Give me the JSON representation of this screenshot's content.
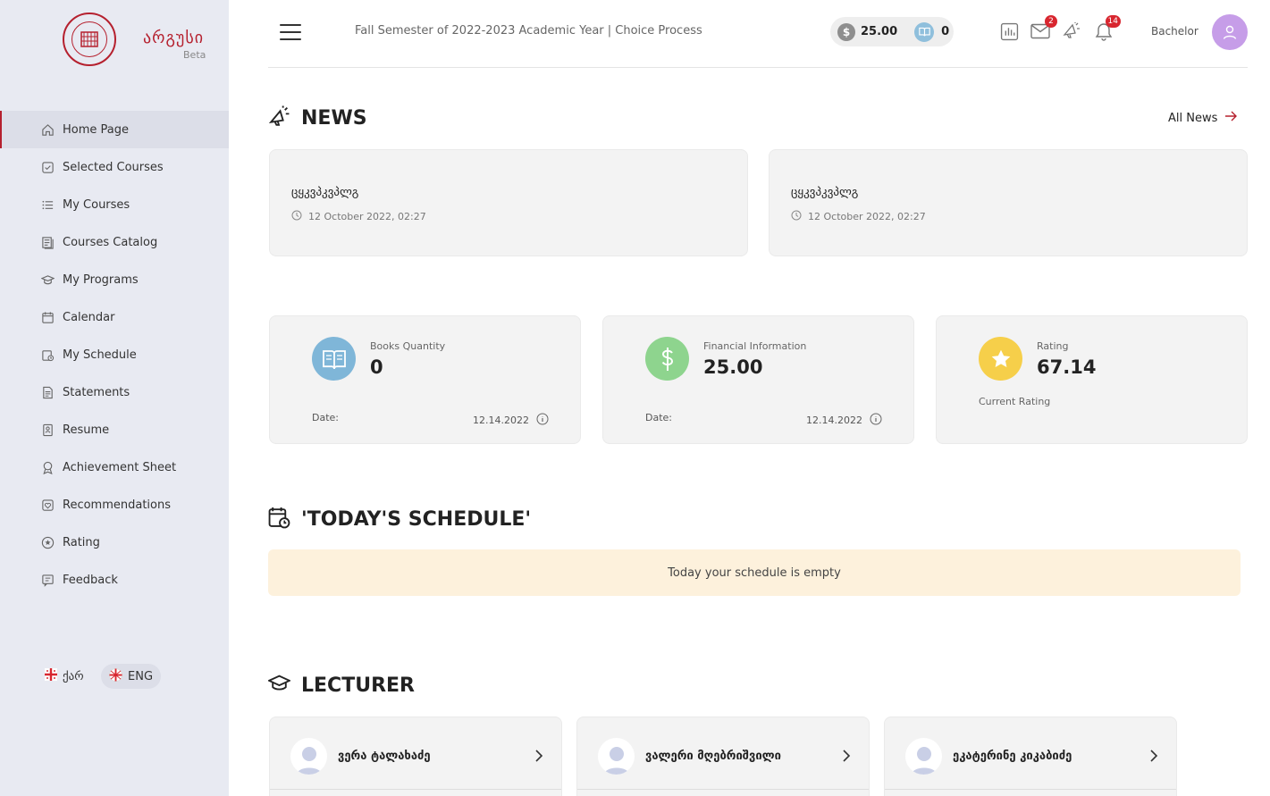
{
  "brand": {
    "name": "არგუსი",
    "tag": "Beta"
  },
  "sidebar": {
    "items": [
      {
        "label": "Home Page",
        "icon": "home-icon",
        "active": true
      },
      {
        "label": "Selected Courses",
        "icon": "checkbox-icon"
      },
      {
        "label": "My Courses",
        "icon": "list-icon"
      },
      {
        "label": "Courses Catalog",
        "icon": "catalog-icon"
      },
      {
        "label": "My Programs",
        "icon": "graduation-cap-icon"
      },
      {
        "label": "Calendar",
        "icon": "calendar-icon"
      },
      {
        "label": "My Schedule",
        "icon": "schedule-icon"
      },
      {
        "label": "Statements",
        "icon": "document-icon"
      },
      {
        "label": "Resume",
        "icon": "resume-icon"
      },
      {
        "label": "Achievement Sheet",
        "icon": "award-icon"
      },
      {
        "label": "Recommendations",
        "icon": "heart-icon"
      },
      {
        "label": "Rating",
        "icon": "star-icon"
      },
      {
        "label": "Feedback",
        "icon": "feedback-icon"
      }
    ],
    "lang": {
      "ka": "ქარ",
      "en": "ENG"
    }
  },
  "header": {
    "semester": "Fall Semester of 2022-2023 Academic Year | Choice Process",
    "balance": "25.00",
    "books": "0",
    "mail_badge": "2",
    "notif_badge": "14",
    "degree": "Bachelor"
  },
  "news": {
    "title": "NEWS",
    "all_link": "All News",
    "items": [
      {
        "title": "ცყკვპკვპლგ",
        "date": "12 October 2022, 02:27"
      },
      {
        "title": "ცყკვპკვპლგ",
        "date": "12 October 2022, 02:27"
      }
    ]
  },
  "stats": {
    "books": {
      "label": "Books Quantity",
      "value": "0",
      "date_label": "Date:",
      "date": "12.14.2022"
    },
    "finance": {
      "label": "Financial Information",
      "value": "25.00",
      "date_label": "Date:",
      "date": "12.14.2022"
    },
    "rating": {
      "label": "Rating",
      "value": "67.14",
      "sub": "Current Rating"
    }
  },
  "schedule": {
    "title": "'TODAY'S SCHEDULE'",
    "empty": "Today your schedule is empty"
  },
  "lecturers": {
    "title": "LECTURER",
    "items": [
      {
        "name": "ვერა ტალახაძე"
      },
      {
        "name": "ვალერი მღებრიშვილი"
      },
      {
        "name": "ეკატერინე კიკაბიძე"
      }
    ]
  },
  "colors": {
    "accent": "#b5202e",
    "sidebar_bg": "#e8eaf2",
    "avatar": "#c69de8",
    "book_blue": "#7fb6d8",
    "money_green": "#8ed48e",
    "star_yellow": "#f6cf4a"
  }
}
